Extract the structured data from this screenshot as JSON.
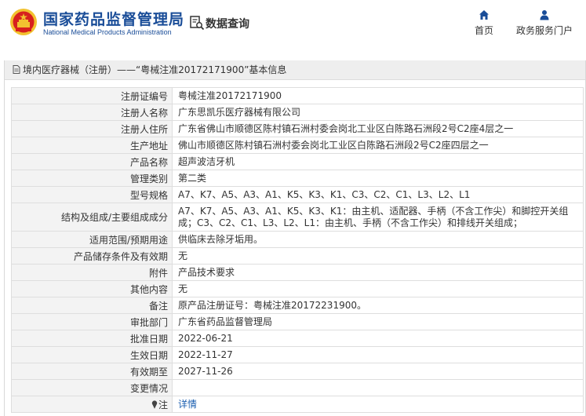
{
  "brand": {
    "name_cn": "国家药品监督管理局",
    "name_en": "National Medical Products Administration"
  },
  "header": {
    "query_title": "数据查询",
    "nav": {
      "home_label": "首页",
      "portal_label": "政务服务门户"
    }
  },
  "section": {
    "title": "境内医疗器械（注册）——“粤械注准20172171900”基本信息"
  },
  "rows": [
    {
      "label": "注册证编号",
      "value": "粤械注准20172171900"
    },
    {
      "label": "注册人名称",
      "value": "广东思凯乐医疗器械有限公司"
    },
    {
      "label": "注册人住所",
      "value": "广东省佛山市顺德区陈村镇石洲村委会岗北工业区白陈路石洲段2号C2座4层之一"
    },
    {
      "label": "生产地址",
      "value": "佛山市顺德区陈村镇石洲村委会岗北工业区白陈路石洲段2号C2座四层之一"
    },
    {
      "label": "产品名称",
      "value": "超声波洁牙机"
    },
    {
      "label": "管理类别",
      "value": "第二类"
    },
    {
      "label": "型号规格",
      "value": "A7、K7、A5、A3、A1、K5、K3、K1、C3、C2、C1、L3、L2、L1"
    },
    {
      "label": "结构及组成/主要组成成分",
      "value": "A7、K7、A5、A3、A1、K5、K3、K1：由主机、适配器、手柄（不含工作尖）和脚控开关组成；C3、C2、C1、L3、L2、L1：由主机、手柄（不含工作尖）和排线开关组成；"
    },
    {
      "label": "适用范围/预期用途",
      "value": "供临床去除牙垢用。"
    },
    {
      "label": "产品储存条件及有效期",
      "value": "无"
    },
    {
      "label": "附件",
      "value": "产品技术要求"
    },
    {
      "label": "其他内容",
      "value": "无"
    },
    {
      "label": "备注",
      "value": "原产品注册证号：粤械注准20172231900。"
    },
    {
      "label": "审批部门",
      "value": "广东省药品监督管理局"
    },
    {
      "label": "批准日期",
      "value": "2022-06-21"
    },
    {
      "label": "生效日期",
      "value": "2022-11-27"
    },
    {
      "label": "有效期至",
      "value": "2027-11-26"
    },
    {
      "label": "变更情况",
      "value": ""
    },
    {
      "label": "注",
      "value": "详情"
    }
  ],
  "colors": {
    "brand_blue": "#1a4d98",
    "emblem_red": "#d7201e",
    "emblem_gold": "#f2c230",
    "link_blue": "#1b5fb0"
  },
  "icons": {
    "emblem": "national-emblem-icon",
    "query": "document-search-icon",
    "home": "home-icon",
    "portal": "person-icon",
    "section": "document-icon",
    "note": "pin-icon"
  }
}
